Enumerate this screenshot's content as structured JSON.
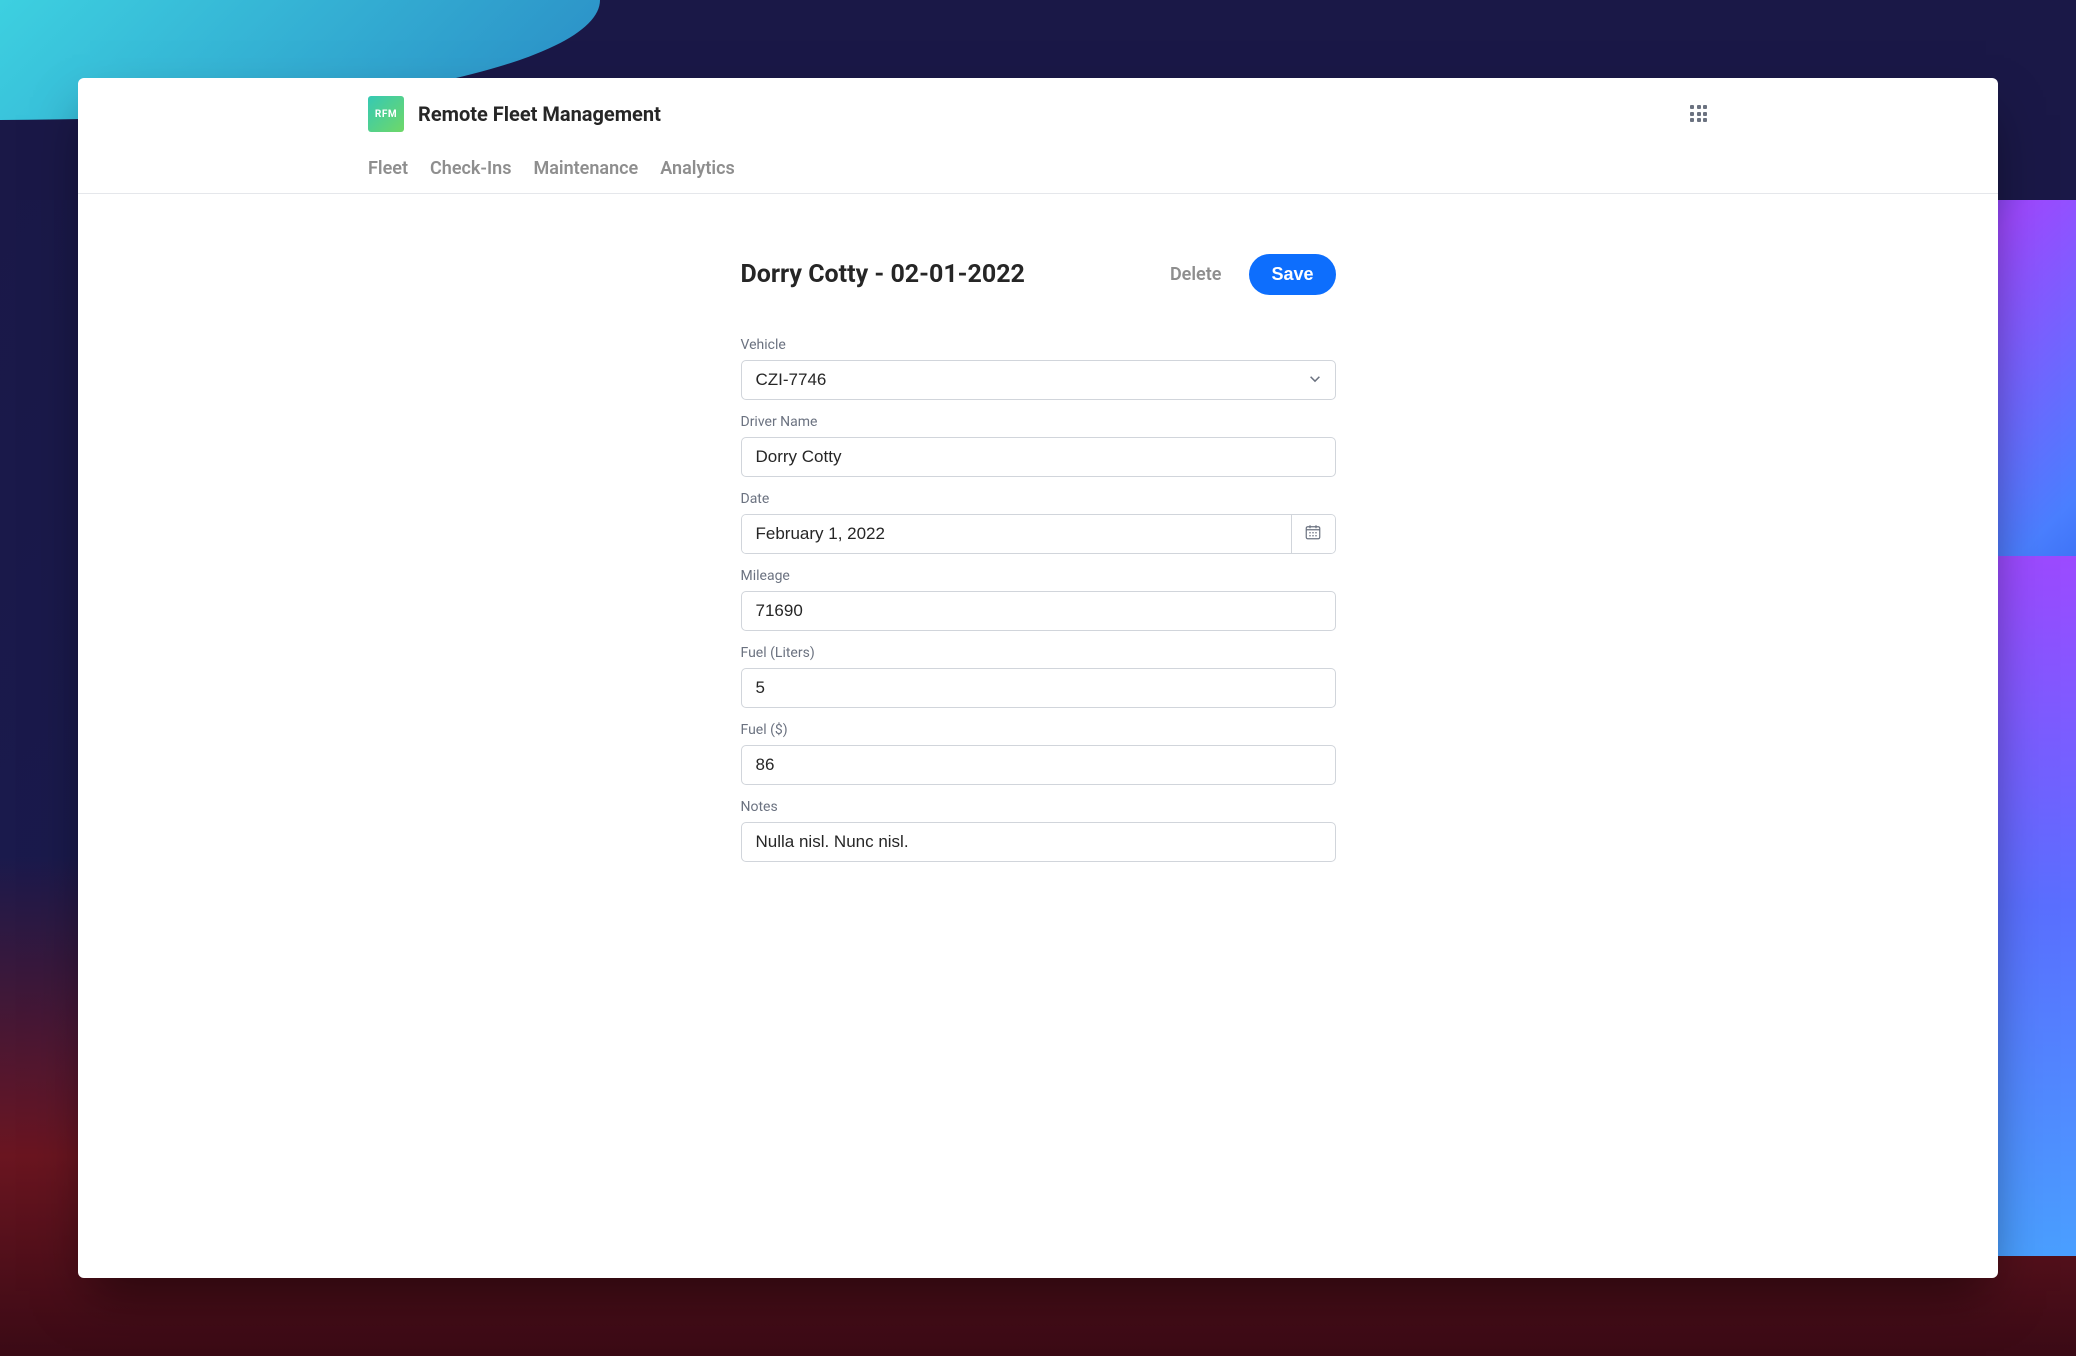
{
  "app": {
    "icon_text": "RFM",
    "title": "Remote Fleet Management"
  },
  "nav": {
    "items": [
      {
        "label": "Fleet"
      },
      {
        "label": "Check-Ins"
      },
      {
        "label": "Maintenance"
      },
      {
        "label": "Analytics"
      }
    ]
  },
  "page": {
    "title": "Dorry Cotty - 02-01-2022",
    "actions": {
      "delete_label": "Delete",
      "save_label": "Save"
    }
  },
  "form": {
    "vehicle": {
      "label": "Vehicle",
      "value": "CZI-7746"
    },
    "driver_name": {
      "label": "Driver Name",
      "value": "Dorry Cotty"
    },
    "date": {
      "label": "Date",
      "value": "February 1, 2022"
    },
    "mileage": {
      "label": "Mileage",
      "value": "71690"
    },
    "fuel_liters": {
      "label": "Fuel (Liters)",
      "value": "5"
    },
    "fuel_dollars": {
      "label": "Fuel ($)",
      "value": "86"
    },
    "notes": {
      "label": "Notes",
      "value": "Nulla nisl. Nunc nisl."
    }
  }
}
